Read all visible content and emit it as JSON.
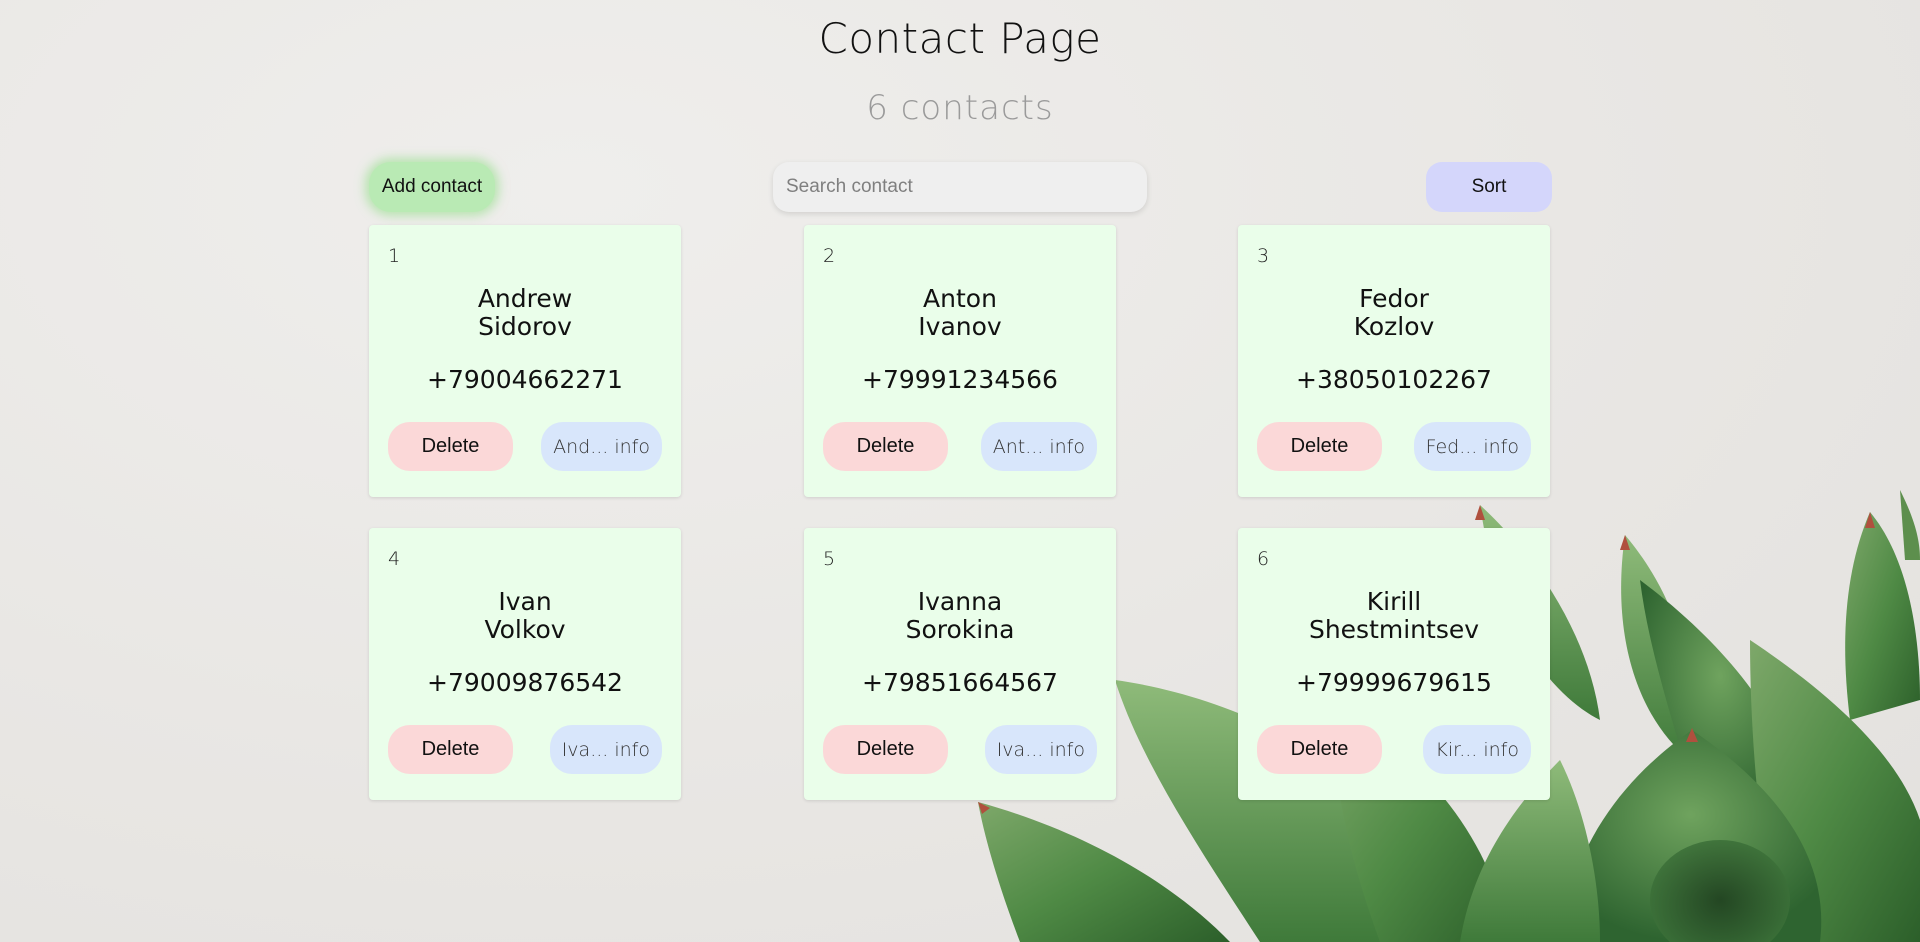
{
  "header": {
    "title": "Contact Page",
    "count_text": "6 contacts"
  },
  "toolbar": {
    "add_label": "Add contact",
    "search_placeholder": "Search contact",
    "search_value": "",
    "sort_label": "Sort"
  },
  "contacts": [
    {
      "num": "1",
      "first": "Andrew",
      "last": "Sidorov",
      "phone": "+79004662271",
      "delete_label": "Delete",
      "info_label": "And... info"
    },
    {
      "num": "2",
      "first": "Anton",
      "last": "Ivanov",
      "phone": "+79991234566",
      "delete_label": "Delete",
      "info_label": "Ant... info"
    },
    {
      "num": "3",
      "first": "Fedor",
      "last": "Kozlov",
      "phone": "+38050102267",
      "delete_label": "Delete",
      "info_label": "Fed... info"
    },
    {
      "num": "4",
      "first": "Ivan",
      "last": "Volkov",
      "phone": "+79009876542",
      "delete_label": "Delete",
      "info_label": "Iva... info"
    },
    {
      "num": "5",
      "first": "Ivanna",
      "last": "Sorokina",
      "phone": "+79851664567",
      "delete_label": "Delete",
      "info_label": "Iva... info"
    },
    {
      "num": "6",
      "first": "Kirill",
      "last": "Shestmintsev",
      "phone": "+79999679615",
      "delete_label": "Delete",
      "info_label": "Kir... info"
    }
  ],
  "colors": {
    "card_bg": "#eafeea",
    "add_button": "#b9eab4",
    "sort_button": "#d4d6fb",
    "delete_button": "#fbd8d8",
    "info_button": "#d8e6fb"
  },
  "background": {
    "image": "succulent-plant"
  }
}
